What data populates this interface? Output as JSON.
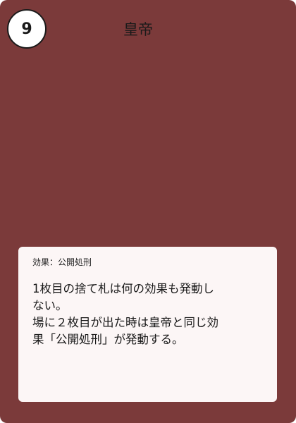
{
  "card": {
    "number": "9",
    "name": "皇帝",
    "background_color": "#7b3a3a",
    "text_box_color": "#fcf6f6"
  },
  "effect": {
    "label": "効果：公開処刑",
    "lines": [
      "1枚目の捨て札は何の効果も発動し",
      "ない。",
      "場に２枚目が出た時は皇帝と同じ効",
      "果「公開処刑」が発動する。"
    ]
  }
}
